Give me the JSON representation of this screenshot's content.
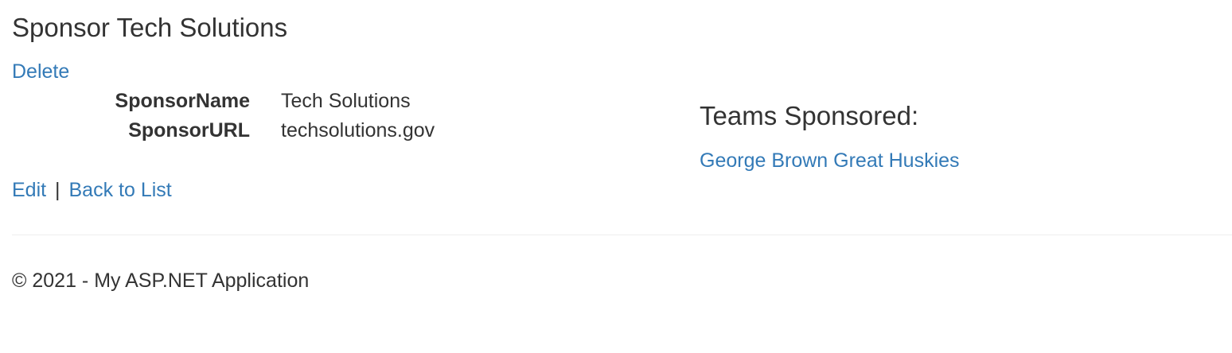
{
  "page": {
    "title": "Sponsor Tech Solutions",
    "delete_label": "Delete"
  },
  "details": {
    "rows": [
      {
        "label": "SponsorName",
        "value": "Tech Solutions"
      },
      {
        "label": "SponsorURL",
        "value": "techsolutions.gov"
      }
    ]
  },
  "actions": {
    "edit_label": "Edit",
    "separator": "|",
    "back_label": "Back to List"
  },
  "teams": {
    "heading": "Teams Sponsored:",
    "items": [
      {
        "name": "George Brown Great Huskies"
      }
    ]
  },
  "footer": {
    "text": "© 2021 - My ASP.NET Application"
  },
  "colors": {
    "link": "#337ab7",
    "text": "#333333",
    "divider": "#eeeeee"
  }
}
